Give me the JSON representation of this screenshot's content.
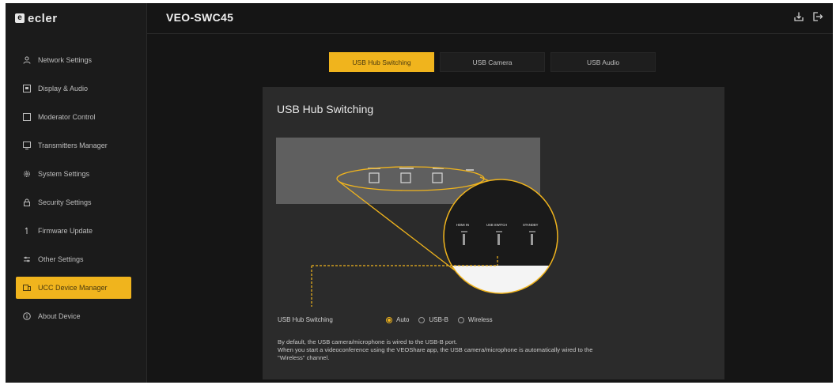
{
  "brand": {
    "logo_mark": "e",
    "logo_text": "ecler"
  },
  "header": {
    "title": "VEO-SWC45",
    "icons": [
      "download-icon",
      "logout-icon"
    ]
  },
  "sidebar": {
    "items": [
      {
        "label": "Network Settings",
        "icon": "user-icon"
      },
      {
        "label": "Display & Audio",
        "icon": "display-icon"
      },
      {
        "label": "Moderator Control",
        "icon": "square-icon"
      },
      {
        "label": "Transmitters Manager",
        "icon": "monitor-icon"
      },
      {
        "label": "System Settings",
        "icon": "gear-icon"
      },
      {
        "label": "Security Settings",
        "icon": "lock-icon"
      },
      {
        "label": "Firmware Update",
        "icon": "firmware-icon"
      },
      {
        "label": "Other Settings",
        "icon": "sliders-icon"
      },
      {
        "label": "UCC Device Manager",
        "icon": "device-icon",
        "active": true
      },
      {
        "label": "About Device",
        "icon": "info-icon"
      }
    ]
  },
  "tabs": [
    {
      "label": "USB Hub Switching",
      "active": true
    },
    {
      "label": "USB Camera",
      "active": false
    },
    {
      "label": "USB Audio",
      "active": false
    }
  ],
  "panel": {
    "title": "USB Hub Switching",
    "switching": {
      "label": "USB Hub Switching",
      "options": [
        {
          "label": "Auto",
          "selected": true
        },
        {
          "label": "USB-B",
          "selected": false
        },
        {
          "label": "Wireless",
          "selected": false
        }
      ]
    },
    "description": [
      "By default, the USB camera/microphone is wired to the USB-B port.",
      "When you start a videoconference using the VEOShare app, the USB camera/microphone is automatically wired to the",
      "\"Wireless\" channel."
    ],
    "photo_labels": {
      "hdmi": "HDMI IN",
      "usb_switch": "USB SWITCH",
      "standby": "STANDBY"
    }
  },
  "colors": {
    "accent": "#f0b41d",
    "background": "#151515",
    "panel": "#2b2b2b"
  }
}
